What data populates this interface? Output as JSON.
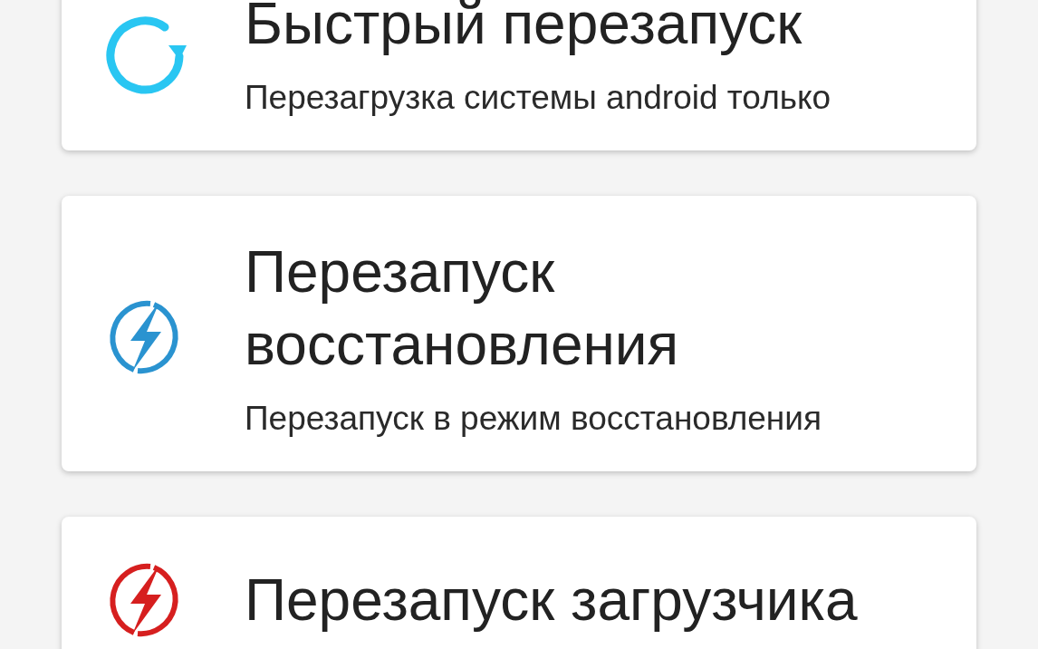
{
  "options": [
    {
      "kind": "refresh",
      "color": "#29c6f2",
      "title": "Быстрый перезапуск",
      "subtitle": "Перезагрузка системы android только"
    },
    {
      "kind": "bolt",
      "color": "#2a93d0",
      "title": "Перезапуск восстановления",
      "subtitle": "Перезапуск в режим восстановления"
    },
    {
      "kind": "bolt",
      "color": "#d61f1f",
      "title": "Перезапуск загрузчика"
    }
  ]
}
